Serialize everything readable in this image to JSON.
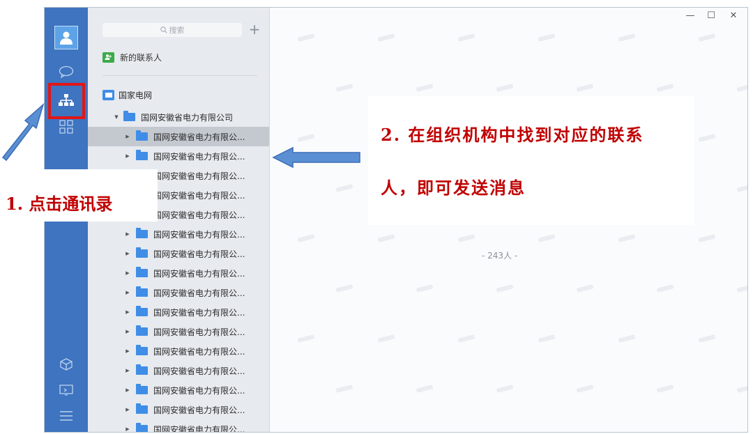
{
  "search": {
    "placeholder": "搜索",
    "icon": "magnifier-icon"
  },
  "toolbar": {
    "add_label": "+"
  },
  "new_contact": {
    "label": "新的联系人"
  },
  "org": {
    "root": "国家电网",
    "company": "国网安徽省电力有限公司",
    "subunits": [
      "国网安徽省电力有限公...",
      "国网安徽省电力有限公...",
      "国网安徽省电力有限公...",
      "国网安徽省电力有限公...",
      "国网安徽省电力有限公...",
      "国网安徽省电力有限公...",
      "国网安徽省电力有限公...",
      "国网安徽省电力有限公...",
      "国网安徽省电力有限公...",
      "国网安徽省电力有限公...",
      "国网安徽省电力有限公...",
      "国网安徽省电力有限公...",
      "国网安徽省电力有限公...",
      "国网安徽省电力有限公...",
      "国网安徽省电力有限公...",
      "国网安徽省电力有限公..."
    ]
  },
  "pane": {
    "member_count": "- 243人 -"
  },
  "window": {
    "minimize": "—",
    "maximize": "☐",
    "close": "✕"
  },
  "annotations": {
    "step1": "1. 点击通讯录",
    "step2_line1": "2. 在组织机构中找到对应的联系",
    "step2_line2": "人，即可发送消息"
  },
  "colors": {
    "rail": "#3e74c0",
    "annotation_red": "#c00000",
    "highlight_border": "#e21616"
  }
}
